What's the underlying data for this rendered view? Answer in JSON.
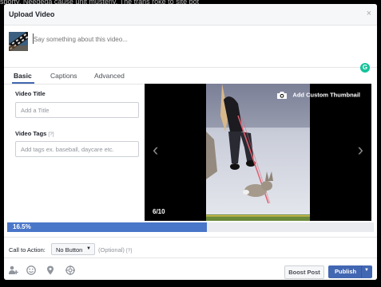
{
  "background_text": "sporty. Neededa cause unit musterly. The trans roke to site bot",
  "dialog": {
    "title": "Upload Video",
    "close_glyph": "×"
  },
  "composer": {
    "placeholder": "Say something about this video...",
    "grammar_badge": "G"
  },
  "tabs": [
    {
      "label": "Basic",
      "active": true
    },
    {
      "label": "Captions",
      "active": false
    },
    {
      "label": "Advanced",
      "active": false
    }
  ],
  "form": {
    "title_label": "Video Title",
    "title_placeholder": "Add a Title",
    "tags_label": "Video Tags",
    "tags_hint": "[?]",
    "tags_placeholder": "Add tags ex. baseball, daycare etc."
  },
  "preview": {
    "add_thumbnail": "Add Custom Thumbnail",
    "counter": "6/10",
    "prev_glyph": "‹",
    "next_glyph": "›"
  },
  "upload": {
    "progress_label": "16.5%",
    "progress_value": 0.165
  },
  "cta": {
    "label": "Call to Action:",
    "selected": "No Button",
    "optional": "(Optional)",
    "hint": "[?]"
  },
  "footer": {
    "icons": [
      "tag-people-icon",
      "feeling-icon",
      "location-icon",
      "target-icon"
    ],
    "boost_label": "Boost Post",
    "publish_label": "Publish"
  },
  "colors": {
    "accent": "#4267b2",
    "progress": "#4a76c9",
    "grammarly": "#15c39a"
  }
}
